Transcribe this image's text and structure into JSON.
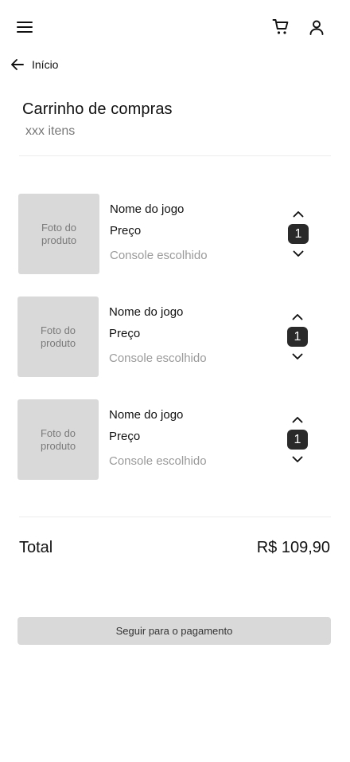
{
  "header": {
    "menu_icon": "menu-icon",
    "cart_icon": "cart-icon",
    "user_icon": "user-icon"
  },
  "breadcrumb": {
    "back_label": "Início",
    "back_icon": "arrow-left-icon"
  },
  "cart": {
    "title": "Carrinho de compras",
    "item_count": "xxx itens",
    "items": [
      {
        "photo_label": "Foto do produto",
        "name": "Nome do jogo",
        "price": "Preço",
        "console": "Console escolhido",
        "quantity": "1"
      },
      {
        "photo_label": "Foto do produto",
        "name": "Nome do jogo",
        "price": "Preço",
        "console": "Console escolhido",
        "quantity": "1"
      },
      {
        "photo_label": "Foto do produto",
        "name": "Nome do jogo",
        "price": "Preço",
        "console": "Console escolhido",
        "quantity": "1"
      }
    ],
    "total_label": "Total",
    "total_value": "R$ 109,90",
    "checkout_label": "Seguir para o pagamento"
  },
  "colors": {
    "placeholder_gray": "#d9d9d9",
    "quantity_badge": "#2a2a2a",
    "secondary_text": "#9a9a9a"
  }
}
